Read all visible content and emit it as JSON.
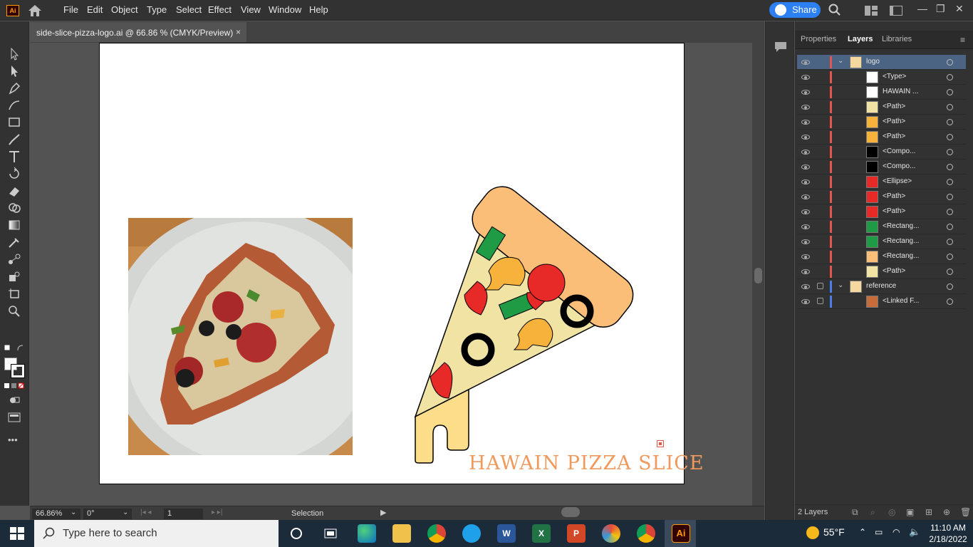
{
  "app": {
    "logo_text": "Ai",
    "accent": "#ff9a00"
  },
  "menu": [
    "File",
    "Edit",
    "Object",
    "Type",
    "Select",
    "Effect",
    "View",
    "Window",
    "Help"
  ],
  "share_label": "Share",
  "document_tab": {
    "title": "side-slice-pizza-logo.ai @ 66.86 % (CMYK/Preview)",
    "close": "×"
  },
  "artwork": {
    "logo_text": "HAWAIN PIZZA SLICE",
    "logo_color": "#f0995c"
  },
  "status": {
    "zoom": "66.86%",
    "rotation": "0°",
    "artboard": "1",
    "tool": "Selection"
  },
  "panel": {
    "tabs": [
      "Properties",
      "Layers",
      "Libraries"
    ],
    "active_tab": "Layers",
    "layers": [
      {
        "name": "logo",
        "type": "layer",
        "color": "#e2564e",
        "selected": true
      },
      {
        "name": "<Type>",
        "type": "item"
      },
      {
        "name": "HAWAIN ...",
        "type": "item"
      },
      {
        "name": "<Path>",
        "type": "item"
      },
      {
        "name": "<Path>",
        "type": "item"
      },
      {
        "name": "<Path>",
        "type": "item"
      },
      {
        "name": "<Compo...",
        "type": "item"
      },
      {
        "name": "<Compo...",
        "type": "item"
      },
      {
        "name": "<Ellipse>",
        "type": "item"
      },
      {
        "name": "<Path>",
        "type": "item"
      },
      {
        "name": "<Path>",
        "type": "item"
      },
      {
        "name": "<Rectang...",
        "type": "item"
      },
      {
        "name": "<Rectang...",
        "type": "item"
      },
      {
        "name": "<Rectang...",
        "type": "item"
      },
      {
        "name": "<Path>",
        "type": "item"
      },
      {
        "name": "reference",
        "type": "layer",
        "color": "#4b7ee8",
        "locked": true
      },
      {
        "name": "<Linked F...",
        "type": "item",
        "locked": true
      }
    ],
    "footer_count": "2 Layers"
  },
  "taskbar": {
    "search_placeholder": "Type here to search",
    "weather": "55°F",
    "time": "11:10 AM",
    "date": "2/18/2022"
  }
}
